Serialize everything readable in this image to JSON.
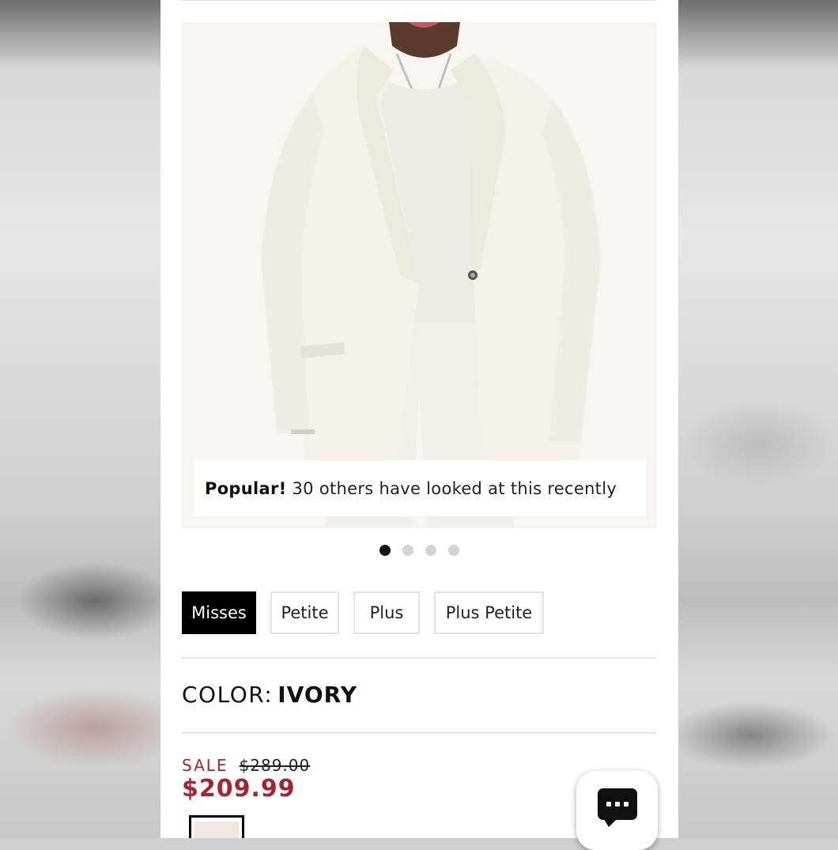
{
  "popular": {
    "label": "Popular!",
    "text": "30 others have looked at this recently"
  },
  "carousel": {
    "count": 4,
    "active": 0
  },
  "sizes": [
    {
      "label": "Misses",
      "selected": true
    },
    {
      "label": "Petite",
      "selected": false
    },
    {
      "label": "Plus",
      "selected": false
    },
    {
      "label": "Plus Petite",
      "selected": false
    }
  ],
  "color": {
    "label": "COLOR:",
    "value": "IVORY",
    "swatch": "#f1e7df"
  },
  "price": {
    "sale_label": "SALE",
    "original": "$289.00",
    "sale": "$209.99"
  },
  "chat": {
    "icon": "chat-icon"
  },
  "colors": {
    "sale_red": "#a3262c",
    "selected_bg": "#000000"
  }
}
